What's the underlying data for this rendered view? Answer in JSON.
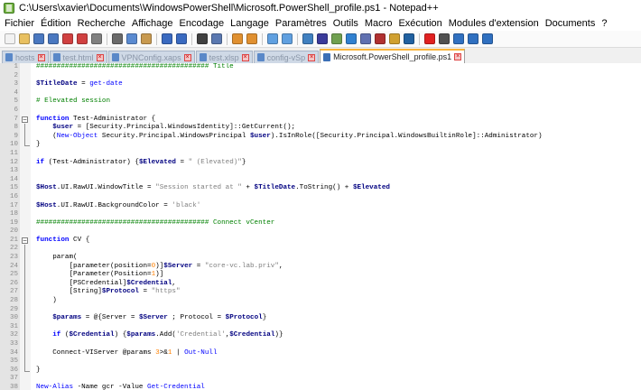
{
  "window": {
    "title": "C:\\Users\\xavier\\Documents\\WindowsPowerShell\\Microsoft.PowerShell_profile.ps1 - Notepad++"
  },
  "menu": [
    "Fichier",
    "Édition",
    "Recherche",
    "Affichage",
    "Encodage",
    "Langage",
    "Paramètres",
    "Outils",
    "Macro",
    "Exécution",
    "Modules d'extension",
    "Documents",
    "?"
  ],
  "toolbar": {
    "buttons": [
      {
        "name": "new-file-icon",
        "color": "#f2f2f2"
      },
      {
        "name": "open-file-icon",
        "color": "#e8c060"
      },
      {
        "name": "save-icon",
        "color": "#4a78c0"
      },
      {
        "name": "save-all-icon",
        "color": "#4a78c0"
      },
      {
        "name": "close-icon",
        "color": "#d04040"
      },
      {
        "name": "close-all-icon",
        "color": "#d04040"
      },
      {
        "name": "print-icon",
        "color": "#808080"
      },
      {
        "sep": true
      },
      {
        "name": "cut-icon",
        "color": "#6a6a6a"
      },
      {
        "name": "copy-icon",
        "color": "#5a8ad0"
      },
      {
        "name": "paste-icon",
        "color": "#c89a50"
      },
      {
        "sep": true
      },
      {
        "name": "undo-icon",
        "color": "#3a6ac0"
      },
      {
        "name": "redo-icon",
        "color": "#3a6ac0"
      },
      {
        "sep": true
      },
      {
        "name": "find-icon",
        "color": "#404040"
      },
      {
        "name": "replace-icon",
        "color": "#5a78b0"
      },
      {
        "sep": true
      },
      {
        "name": "zoom-in-icon",
        "color": "#e09030"
      },
      {
        "name": "zoom-out-icon",
        "color": "#e09030"
      },
      {
        "sep": true
      },
      {
        "name": "sync-vertical-icon",
        "color": "#60a0e0"
      },
      {
        "name": "sync-horizontal-icon",
        "color": "#60a0e0"
      },
      {
        "sep": true
      },
      {
        "name": "word-wrap-icon",
        "color": "#4080c0"
      },
      {
        "name": "show-all-chars-icon",
        "color": "#3a3a9a"
      },
      {
        "name": "indent-guide-icon",
        "color": "#70a050"
      },
      {
        "name": "user-lang-icon",
        "color": "#3080d0"
      },
      {
        "name": "doc-map-icon",
        "color": "#6070b0"
      },
      {
        "name": "function-list-icon",
        "color": "#b03030"
      },
      {
        "name": "folder-workspace-icon",
        "color": "#d0a030"
      },
      {
        "name": "monitoring-icon",
        "color": "#2060a0"
      },
      {
        "sep": true
      },
      {
        "name": "record-macro-icon",
        "color": "#e02020"
      },
      {
        "name": "stop-record-icon",
        "color": "#505050"
      },
      {
        "name": "play-macro-icon",
        "color": "#3070c0"
      },
      {
        "name": "play-multiple-icon",
        "color": "#3070c0"
      },
      {
        "name": "save-macro-icon",
        "color": "#3070c0"
      }
    ]
  },
  "tabs": [
    {
      "label": "hosts",
      "active": false
    },
    {
      "label": "test.html",
      "active": false
    },
    {
      "label": "VPNConfig.xaps",
      "active": false
    },
    {
      "label": "test.xlsp",
      "active": false
    },
    {
      "label": "config-vSp",
      "active": false
    },
    {
      "label": "Microsoft.PowerShell_profile.ps1",
      "active": true
    }
  ],
  "colors": {
    "comment": "#008000",
    "variable": "#000080",
    "keyword": "#0000ff",
    "string": "#808080",
    "number": "#ff8000",
    "tab_accent": "#f9b43a"
  },
  "lines": [
    {
      "n": "1",
      "fold": "",
      "tokens": [
        [
          "com",
          "########################################## Title"
        ]
      ]
    },
    {
      "n": "2",
      "fold": "",
      "tokens": []
    },
    {
      "n": "3",
      "fold": "",
      "tokens": [
        [
          "var",
          "$TitleDate"
        ],
        [
          "txt",
          " = "
        ],
        [
          "cmd",
          "get-date"
        ]
      ]
    },
    {
      "n": "4",
      "fold": "",
      "tokens": []
    },
    {
      "n": "5",
      "fold": "",
      "tokens": [
        [
          "com",
          "# Elevated session"
        ]
      ]
    },
    {
      "n": "6",
      "fold": "",
      "tokens": []
    },
    {
      "n": "7",
      "fold": "box",
      "tokens": [
        [
          "kw",
          "function"
        ],
        [
          "txt",
          " Test-Administrator {"
        ]
      ]
    },
    {
      "n": "8",
      "fold": "vline",
      "tokens": [
        [
          "txt",
          "    "
        ],
        [
          "var",
          "$user"
        ],
        [
          "txt",
          " = [Security.Principal.WindowsIdentity]::GetCurrent();"
        ]
      ]
    },
    {
      "n": "9",
      "fold": "vline",
      "tokens": [
        [
          "txt",
          "    ("
        ],
        [
          "cmd",
          "New-Object"
        ],
        [
          "txt",
          " Security.Principal.WindowsPrincipal "
        ],
        [
          "var",
          "$user"
        ],
        [
          "txt",
          ").IsInRole([Security.Principal.WindowsBuiltinRole]::Administrator)"
        ]
      ]
    },
    {
      "n": "10",
      "fold": "end",
      "tokens": [
        [
          "txt",
          "}"
        ]
      ]
    },
    {
      "n": "11",
      "fold": "",
      "tokens": []
    },
    {
      "n": "12",
      "fold": "",
      "tokens": [
        [
          "kw",
          "if"
        ],
        [
          "txt",
          " (Test-Administrator) {"
        ],
        [
          "var",
          "$Elevated"
        ],
        [
          "txt",
          " = "
        ],
        [
          "str",
          "\" (Elevated)\""
        ],
        [
          "txt",
          "}"
        ]
      ]
    },
    {
      "n": "13",
      "fold": "",
      "tokens": []
    },
    {
      "n": "14",
      "fold": "",
      "tokens": []
    },
    {
      "n": "15",
      "fold": "",
      "tokens": [
        [
          "var",
          "$Host"
        ],
        [
          "txt",
          ".UI.RawUI.WindowTitle = "
        ],
        [
          "str",
          "\"Session started at \""
        ],
        [
          "txt",
          " + "
        ],
        [
          "var",
          "$TitleDate"
        ],
        [
          "txt",
          ".ToString() + "
        ],
        [
          "var",
          "$Elevated"
        ]
      ]
    },
    {
      "n": "16",
      "fold": "",
      "tokens": []
    },
    {
      "n": "17",
      "fold": "",
      "tokens": [
        [
          "var",
          "$Host"
        ],
        [
          "txt",
          ".UI.RawUI.BackgroundColor = "
        ],
        [
          "str",
          "'black'"
        ]
      ]
    },
    {
      "n": "18",
      "fold": "",
      "tokens": []
    },
    {
      "n": "19",
      "fold": "",
      "tokens": [
        [
          "com",
          "########################################## Connect vCenter"
        ]
      ]
    },
    {
      "n": "20",
      "fold": "",
      "tokens": []
    },
    {
      "n": "21",
      "fold": "box",
      "tokens": [
        [
          "kw",
          "function"
        ],
        [
          "txt",
          " CV {"
        ]
      ]
    },
    {
      "n": "22",
      "fold": "vline",
      "tokens": []
    },
    {
      "n": "23",
      "fold": "vline",
      "tokens": [
        [
          "txt",
          "    param("
        ]
      ]
    },
    {
      "n": "24",
      "fold": "vline",
      "tokens": [
        [
          "txt",
          "        [parameter(position="
        ],
        [
          "num",
          "0"
        ],
        [
          "txt",
          ")]"
        ],
        [
          "var",
          "$Server"
        ],
        [
          "txt",
          " = "
        ],
        [
          "str",
          "\"core-vc.lab.priv\""
        ],
        [
          "txt",
          ","
        ]
      ]
    },
    {
      "n": "25",
      "fold": "vline",
      "tokens": [
        [
          "txt",
          "        [Parameter(Position="
        ],
        [
          "num",
          "1"
        ],
        [
          "txt",
          ")]"
        ]
      ]
    },
    {
      "n": "26",
      "fold": "vline",
      "tokens": [
        [
          "txt",
          "        [PSCredential]"
        ],
        [
          "var",
          "$Credential"
        ],
        [
          "txt",
          ","
        ]
      ]
    },
    {
      "n": "27",
      "fold": "vline",
      "tokens": [
        [
          "txt",
          "        [String]"
        ],
        [
          "var",
          "$Protocol"
        ],
        [
          "txt",
          " = "
        ],
        [
          "str",
          "\"https\""
        ]
      ]
    },
    {
      "n": "28",
      "fold": "vline",
      "tokens": [
        [
          "txt",
          "    )"
        ]
      ]
    },
    {
      "n": "29",
      "fold": "vline",
      "tokens": []
    },
    {
      "n": "30",
      "fold": "vline",
      "tokens": [
        [
          "txt",
          "    "
        ],
        [
          "var",
          "$params"
        ],
        [
          "txt",
          " = @{Server = "
        ],
        [
          "var",
          "$Server"
        ],
        [
          "txt",
          " ; Protocol = "
        ],
        [
          "var",
          "$Protocol"
        ],
        [
          "txt",
          "}"
        ]
      ]
    },
    {
      "n": "31",
      "fold": "vline",
      "tokens": []
    },
    {
      "n": "32",
      "fold": "vline",
      "tokens": [
        [
          "txt",
          "    "
        ],
        [
          "kw",
          "if"
        ],
        [
          "txt",
          " ("
        ],
        [
          "var",
          "$Credential"
        ],
        [
          "txt",
          ") {"
        ],
        [
          "var",
          "$params"
        ],
        [
          "txt",
          ".Add("
        ],
        [
          "str",
          "'Credential'"
        ],
        [
          "txt",
          ","
        ],
        [
          "var",
          "$Credential"
        ],
        [
          "txt",
          ")}"
        ]
      ]
    },
    {
      "n": "33",
      "fold": "vline",
      "tokens": []
    },
    {
      "n": "34",
      "fold": "vline",
      "tokens": [
        [
          "txt",
          "    Connect-VIServer @params "
        ],
        [
          "num",
          "3"
        ],
        [
          "txt",
          ">&"
        ],
        [
          "num",
          "1"
        ],
        [
          "txt",
          " | "
        ],
        [
          "cmd",
          "Out-Null"
        ]
      ]
    },
    {
      "n": "35",
      "fold": "vline",
      "tokens": []
    },
    {
      "n": "36",
      "fold": "end",
      "tokens": [
        [
          "txt",
          "}"
        ]
      ]
    },
    {
      "n": "37",
      "fold": "",
      "tokens": []
    },
    {
      "n": "38",
      "fold": "",
      "tokens": [
        [
          "cmd",
          "New-Alias"
        ],
        [
          "txt",
          " -Name gcr -Value "
        ],
        [
          "cmd",
          "Get-Credential"
        ]
      ]
    },
    {
      "n": "39",
      "fold": "",
      "tokens": []
    }
  ]
}
